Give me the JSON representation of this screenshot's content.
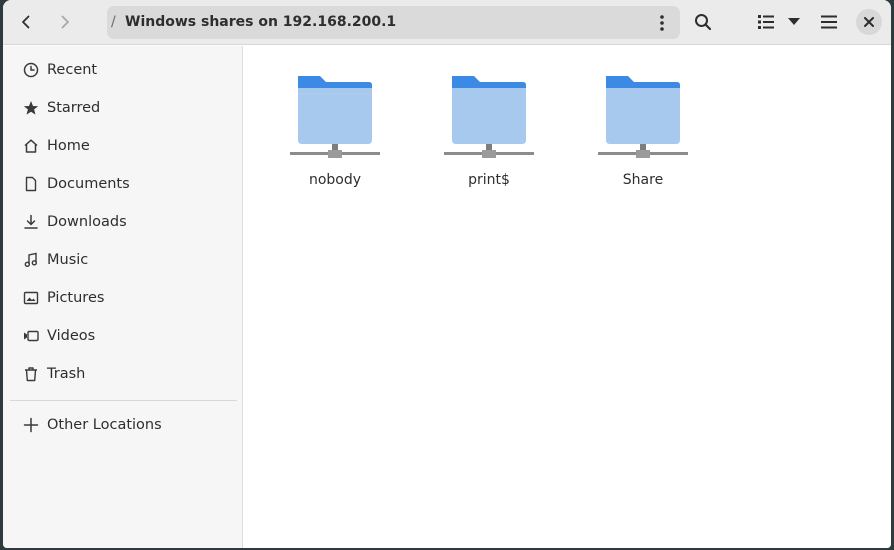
{
  "header": {
    "back_icon": "go-previous-icon",
    "forward_icon": "go-next-icon",
    "path_separator": "/",
    "location": "Windows shares on 192.168.200.1",
    "path_menu_icon": "view-more-vertical-icon",
    "search_icon": "search-icon",
    "view_icon": "view-list-icon",
    "view_options_icon": "pan-down-icon",
    "menu_icon": "open-menu-icon",
    "close_icon": "window-close-icon"
  },
  "sidebar": {
    "items": [
      {
        "label": "Recent",
        "icon": "clock-icon"
      },
      {
        "label": "Starred",
        "icon": "star-icon"
      },
      {
        "label": "Home",
        "icon": "home-icon"
      },
      {
        "label": "Documents",
        "icon": "document-icon"
      },
      {
        "label": "Downloads",
        "icon": "download-icon"
      },
      {
        "label": "Music",
        "icon": "music-icon"
      },
      {
        "label": "Pictures",
        "icon": "picture-icon"
      },
      {
        "label": "Videos",
        "icon": "video-icon"
      },
      {
        "label": "Trash",
        "icon": "trash-icon"
      }
    ],
    "other_locations": {
      "label": "Other Locations",
      "icon": "plus-icon"
    }
  },
  "content": {
    "files": [
      {
        "name": "nobody",
        "icon": "network-folder-icon"
      },
      {
        "name": "print$",
        "icon": "network-folder-icon"
      },
      {
        "name": "Share",
        "icon": "network-folder-icon"
      }
    ]
  },
  "colors": {
    "folder_back": "#3d8ae5",
    "folder_front": "#a7c9ee",
    "headerbar": "#ebebeb",
    "sidebar": "#f6f6f6"
  }
}
